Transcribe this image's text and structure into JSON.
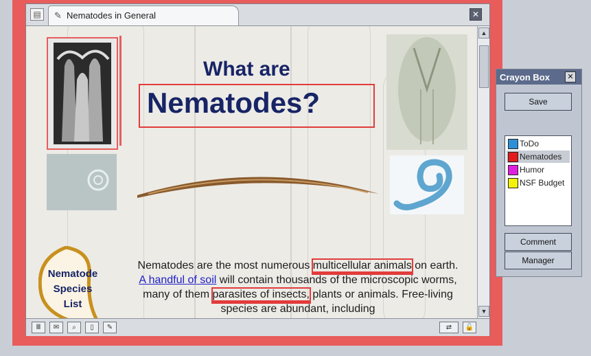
{
  "tab": {
    "title": "Nematodes in General",
    "tab_icon": "pin-icon"
  },
  "content": {
    "heading_line1": "What are",
    "heading_line2": "Nematodes?",
    "species_label": [
      "Nematode",
      "Species",
      "List"
    ],
    "paragraph": {
      "p1": "Nematodes are the most numerous ",
      "hl1": "multicellular animals",
      "p2": " on earth. ",
      "link": "A handful of soil",
      "p3": " will contain thousands of the microscopic worms, many of them ",
      "hl2": "parasites of insects,",
      "p4": " plants or animals. Free-living species are abundant, including"
    }
  },
  "palette": {
    "title": "Crayon Box",
    "save": "Save",
    "comment": "Comment",
    "manager": "Manager",
    "items": [
      {
        "label": "ToDo",
        "color": "#2e8fd6"
      },
      {
        "label": "Nematodes",
        "color": "#e51b1b"
      },
      {
        "label": "Humor",
        "color": "#e020e0"
      },
      {
        "label": "NSF Budget",
        "color": "#f2f20c"
      }
    ],
    "selected": "Nematodes"
  },
  "colors": {
    "annotation": "#e85c5c",
    "heading": "#172466",
    "link": "#2020c8"
  }
}
